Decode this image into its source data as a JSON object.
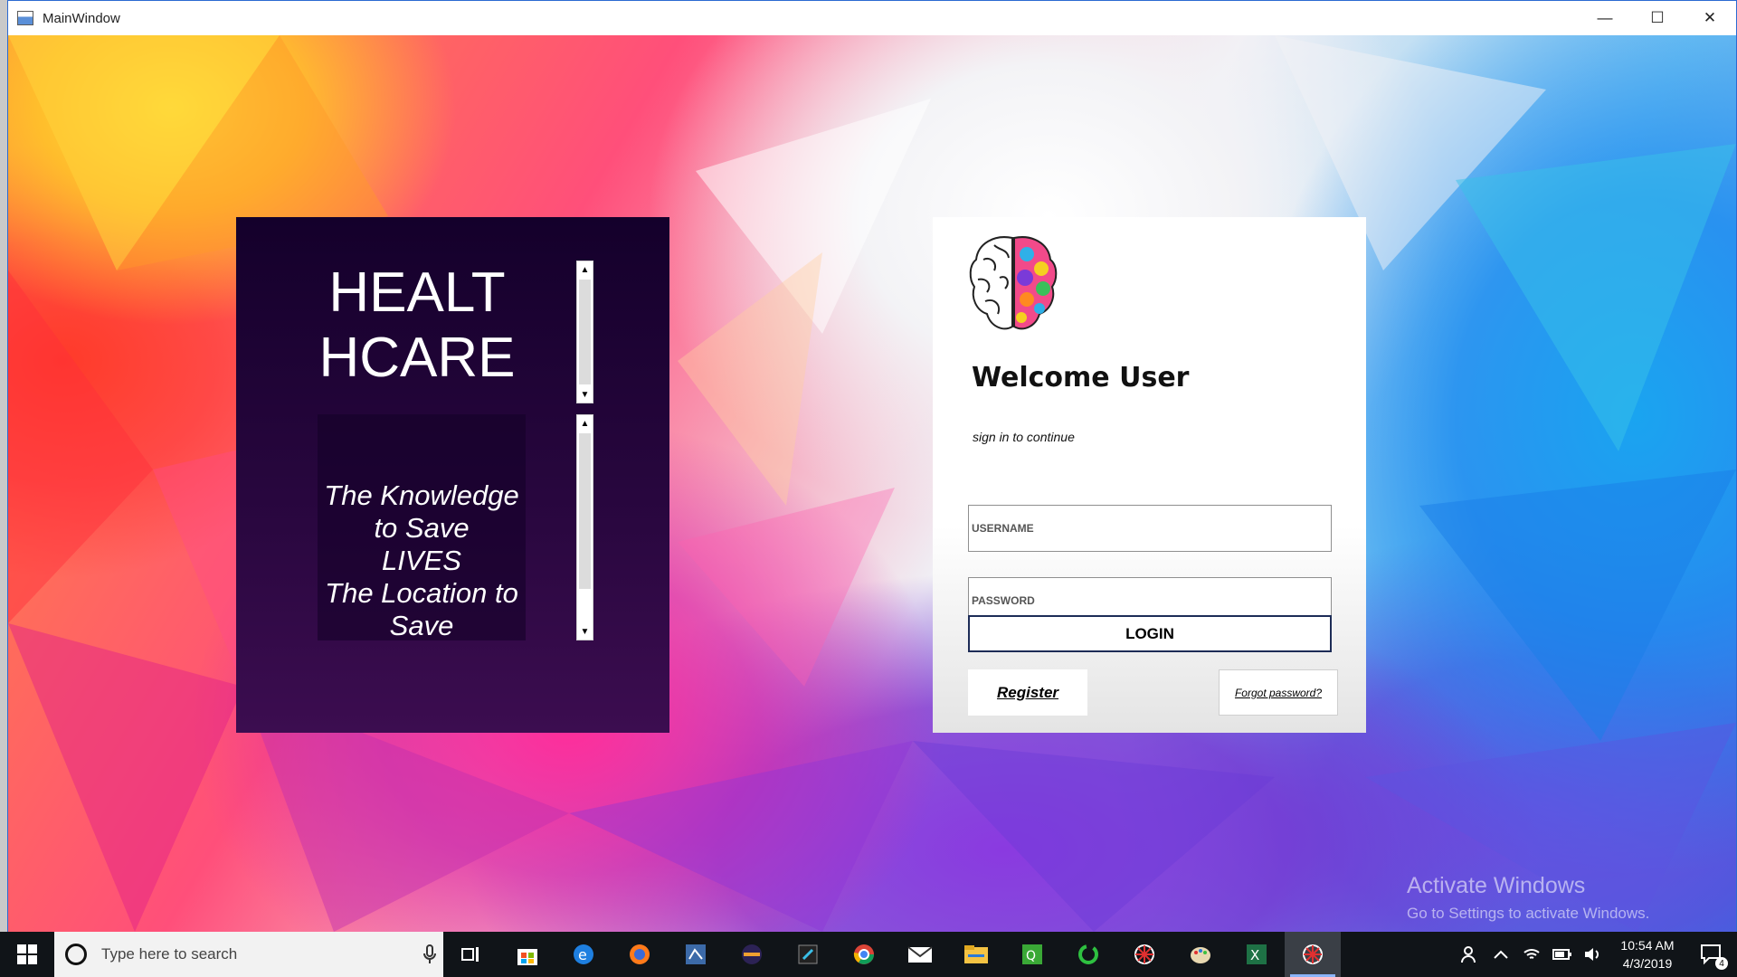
{
  "window": {
    "title": "MainWindow",
    "controls": {
      "minimize": "—",
      "maximize": "☐",
      "close": "✕"
    }
  },
  "banner": {
    "title": "HEALTHCARE",
    "tagline": "The Knowledge to Save\nLIVES\nThe Location to Save"
  },
  "login": {
    "welcome": "Welcome User",
    "subtitle": "sign in to continue",
    "username_placeholder": "USERNAME",
    "password_placeholder": "PASSWORD",
    "login_label": "LOGIN",
    "register_label": "Register",
    "forgot_label": "Forgot password?"
  },
  "watermark": {
    "line1": "Activate Windows",
    "line2": "Go to Settings to activate Windows."
  },
  "taskbar": {
    "search_placeholder": "Type here to search",
    "pinned_icons": [
      "task-view-icon",
      "store-icon",
      "edge-icon",
      "firefox-like-icon",
      "app-blue-icon",
      "eclipse-icon",
      "app-dark-icon",
      "chrome-icon",
      "mail-icon",
      "file-explorer-icon",
      "qlik-icon",
      "green-ring-icon",
      "spider-app-icon",
      "paint-icon",
      "excel-icon",
      "spider-app-active-icon"
    ],
    "time": "10:54 AM",
    "date": "4/3/2019",
    "notifications": "4"
  }
}
